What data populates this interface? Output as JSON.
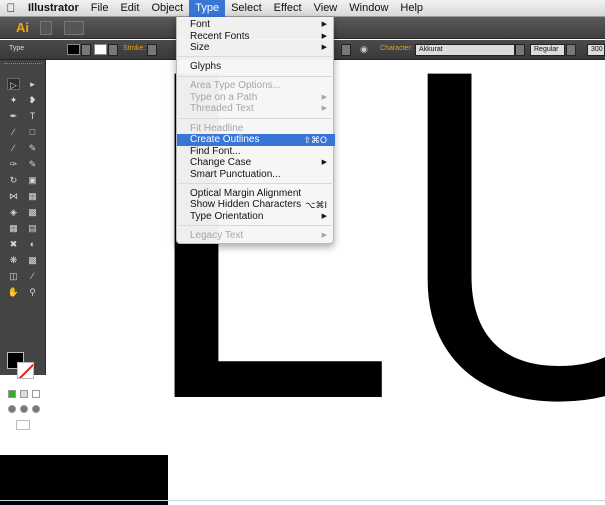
{
  "menubar": {
    "app": "Illustrator",
    "items": [
      "File",
      "Edit",
      "Object",
      "Type",
      "Select",
      "Effect",
      "View",
      "Window",
      "Help"
    ]
  },
  "appbar": {
    "logo": "Ai"
  },
  "controlbar": {
    "mode_label": "Type",
    "stroke_label": "Stroke:",
    "character_label": "Character:",
    "font_value": "Akkurat",
    "style_value": "Regular",
    "size_value": "300"
  },
  "canvas": {
    "letters": "LUS"
  },
  "type_menu": {
    "items": [
      {
        "label": "Font",
        "submenu": true,
        "disabled": false
      },
      {
        "label": "Recent Fonts",
        "submenu": true,
        "disabled": false
      },
      {
        "label": "Size",
        "submenu": true,
        "disabled": false
      },
      {
        "label": "Glyphs",
        "submenu": false,
        "disabled": false
      },
      {
        "label": "Area Type Options...",
        "submenu": false,
        "disabled": true
      },
      {
        "label": "Type on a Path",
        "submenu": true,
        "disabled": true
      },
      {
        "label": "Threaded Text",
        "submenu": true,
        "disabled": true
      },
      {
        "label": "Fit Headline",
        "submenu": false,
        "disabled": true
      },
      {
        "label": "Create Outlines",
        "shortcut": "⇧⌘O",
        "disabled": false,
        "highlighted": true
      },
      {
        "label": "Find Font...",
        "submenu": false,
        "disabled": false
      },
      {
        "label": "Change Case",
        "submenu": true,
        "disabled": false
      },
      {
        "label": "Smart Punctuation...",
        "submenu": false,
        "disabled": false
      },
      {
        "label": "Optical Margin Alignment",
        "submenu": false,
        "disabled": false
      },
      {
        "label": "Show Hidden Characters",
        "shortcut": "⌥⌘I",
        "disabled": false
      },
      {
        "label": "Type Orientation",
        "submenu": true,
        "disabled": false
      },
      {
        "label": "Legacy Text",
        "submenu": true,
        "disabled": true
      }
    ]
  },
  "colors": {
    "highlight": "#3875d7",
    "ai_logo": "#f4a300",
    "panel": "#444444"
  },
  "icons": [
    "apple-icon",
    "selection-tool-icon",
    "direct-selection-tool-icon",
    "pen-tool-icon",
    "type-tool-icon",
    "fill-swatch-icon",
    "stroke-swatch-icon"
  ]
}
